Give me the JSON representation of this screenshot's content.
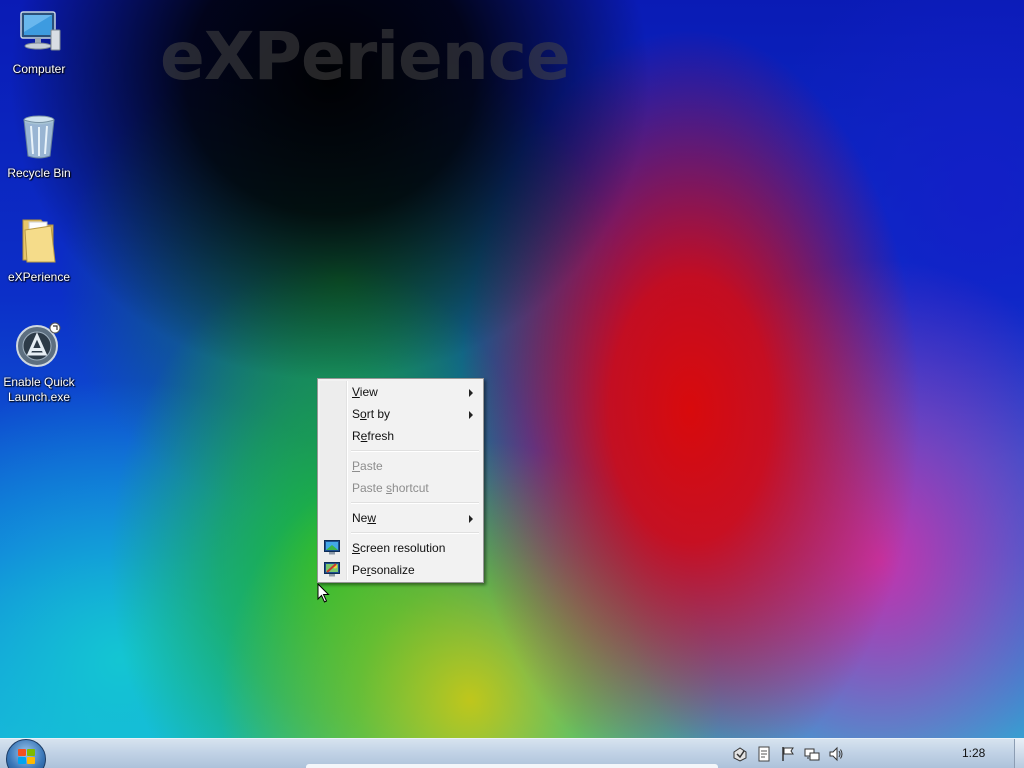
{
  "wallpaper": {
    "text": "eXPerience"
  },
  "desktop_icons": [
    {
      "label": "Computer",
      "icon": "computer-icon"
    },
    {
      "label": "Recycle Bin",
      "icon": "recycle-bin-icon"
    },
    {
      "label": "eXPerience",
      "icon": "folder-icon"
    },
    {
      "label": "Enable Quick\nLaunch.exe",
      "icon": "app-shortcut-icon"
    }
  ],
  "context_menu": {
    "view": {
      "label": "View",
      "key": "V",
      "rest": "iew"
    },
    "sort_by": {
      "label": "Sort by",
      "key": "o",
      "pre": "S",
      "rest": "rt by"
    },
    "refresh": {
      "label": "Refresh",
      "pre": "R",
      "key": "e",
      "rest": "fresh"
    },
    "paste": {
      "label": "Paste",
      "key": "P",
      "rest": "aste",
      "disabled": true
    },
    "paste_shortcut": {
      "label": "Paste shortcut",
      "pre": "Paste ",
      "key": "s",
      "rest": "hortcut",
      "disabled": true
    },
    "new": {
      "label": "New",
      "pre": "Ne",
      "key": "w",
      "rest": ""
    },
    "screen_resolution": {
      "label": "Screen resolution",
      "key": "C",
      "rest": "creen resolution",
      "icon": "display-icon"
    },
    "personalize": {
      "label": "Personalize",
      "pre": "Pe",
      "key": "r",
      "rest": "sonalize",
      "icon": "personalize-icon"
    }
  },
  "taskbar": {
    "clock": "1:28",
    "tray_icons": [
      "action-center-icon",
      "notes-icon",
      "flag-icon",
      "network-icon",
      "volume-icon"
    ]
  },
  "colors": {
    "menu_bg": "#f2f2f2",
    "taskbar": "#c2d3e6",
    "disabled_text": "#8d8d8d"
  }
}
